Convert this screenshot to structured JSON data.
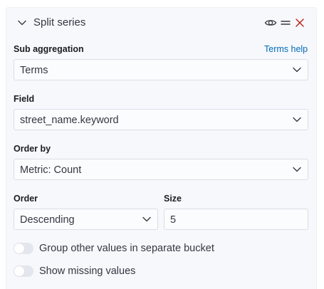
{
  "header": {
    "title": "Split series",
    "icons": [
      "chevron-down-icon",
      "eye-icon",
      "drag-handle-icon",
      "close-icon"
    ],
    "close_color": "#bd271e"
  },
  "sub_aggregation": {
    "label": "Sub aggregation",
    "help_link": "Terms help",
    "value": "Terms"
  },
  "field": {
    "label": "Field",
    "value": "street_name.keyword"
  },
  "order_by": {
    "label": "Order by",
    "value": "Metric: Count"
  },
  "order": {
    "label": "Order",
    "value": "Descending"
  },
  "size": {
    "label": "Size",
    "value": "5"
  },
  "toggles": {
    "group_other": {
      "label": "Group other values in separate bucket",
      "checked": false
    },
    "show_missing": {
      "label": "Show missing values",
      "checked": false
    }
  },
  "colors": {
    "link": "#006bb8",
    "panel_bg": "#f7f8fc",
    "input_border": "#d9dde5"
  }
}
